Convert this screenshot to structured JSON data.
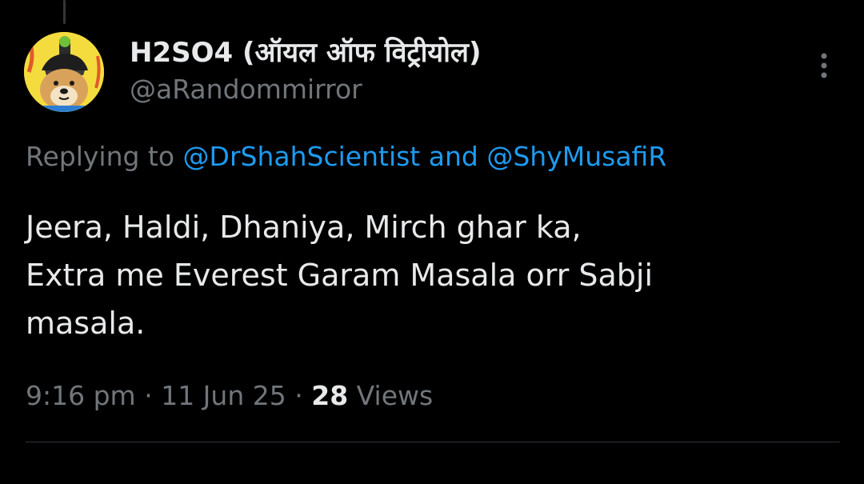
{
  "tweet": {
    "display_name": "H2SO4 (ऑयल ऑफ विट्रीयोल)",
    "handle": "@aRandommirror",
    "avatar_icon": "shiba-doge-avatar",
    "more_icon": "more-vertical-icon",
    "reply_prefix": "Replying to",
    "reply_mention_1": "@DrShahScientist",
    "reply_and": "and",
    "reply_mention_2": "@ShyMusafiR",
    "text_lines": [
      "Jeera, Haldi, Dhaniya, Mirch ghar ka,",
      "Extra me Everest Garam Masala orr Sabji",
      "masala."
    ],
    "time": "9:16 pm",
    "date": "11 Jun 25",
    "separator": "·",
    "views_count": "28",
    "views_label": "Views"
  },
  "colors": {
    "background": "#000000",
    "primary_text": "#e7e9ea",
    "secondary_text": "#71767b",
    "link": "#1d9bf0",
    "divider": "#2f3336"
  }
}
